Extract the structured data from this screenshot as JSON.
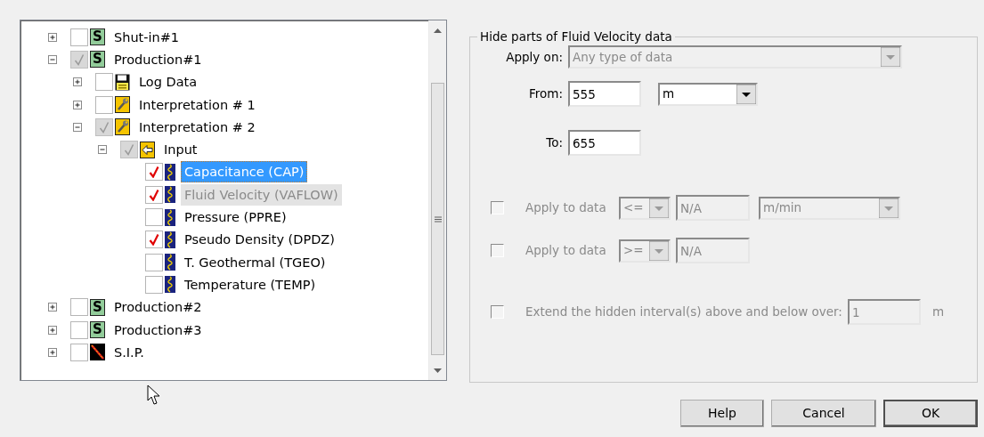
{
  "tree": [
    {
      "label": "Shut-in#1",
      "kind": "s",
      "icon_letter": "S",
      "checked": false,
      "selected": false,
      "dimmed": false,
      "expanded": false
    },
    {
      "label": "Production#1",
      "kind": "s",
      "icon_letter": "S",
      "checked": true,
      "greyed": true,
      "selected": false,
      "dimmed": false,
      "expanded": true,
      "children": [
        {
          "label": "Log Data",
          "kind": "disk",
          "checked": false,
          "selected": false,
          "dimmed": false,
          "expanded": false
        },
        {
          "label": "Interpretation # 1",
          "kind": "wrench",
          "checked": false,
          "selected": false,
          "dimmed": false,
          "expanded": false
        },
        {
          "label": "Interpretation # 2",
          "kind": "wrench",
          "checked": true,
          "greyed": true,
          "selected": false,
          "dimmed": false,
          "expanded": true,
          "children": [
            {
              "label": "Input",
              "kind": "input",
              "checked": true,
              "greyed": true,
              "selected": false,
              "dimmed": false,
              "expanded": true,
              "children": [
                {
                  "label": "Capacitance (CAP)",
                  "kind": "curve",
                  "checked": true,
                  "greyed": false,
                  "selected": true,
                  "dimmed": false
                },
                {
                  "label": "Fluid Velocity (VAFLOW)",
                  "kind": "curve",
                  "checked": true,
                  "greyed": false,
                  "selected": false,
                  "dimmed": true
                },
                {
                  "label": "Pressure (PPRE)",
                  "kind": "curve",
                  "checked": false,
                  "selected": false,
                  "dimmed": false
                },
                {
                  "label": "Pseudo Density (DPDZ)",
                  "kind": "curve",
                  "checked": true,
                  "greyed": false,
                  "selected": false,
                  "dimmed": false
                },
                {
                  "label": "T. Geothermal (TGEO)",
                  "kind": "curve",
                  "checked": false,
                  "selected": false,
                  "dimmed": false
                },
                {
                  "label": "Temperature (TEMP)",
                  "kind": "curve",
                  "checked": false,
                  "selected": false,
                  "dimmed": false
                }
              ]
            }
          ]
        }
      ]
    },
    {
      "label": "Production#2",
      "kind": "s",
      "icon_letter": "S",
      "checked": false,
      "selected": false,
      "dimmed": false,
      "expanded": false
    },
    {
      "label": "Production#3",
      "kind": "s",
      "icon_letter": "S",
      "checked": false,
      "selected": false,
      "dimmed": false,
      "expanded": false
    },
    {
      "label": "S.I.P.",
      "kind": "sip",
      "checked": false,
      "selected": false,
      "dimmed": false,
      "expanded": false
    }
  ],
  "group": {
    "title": "Hide parts of Fluid Velocity data",
    "apply_on": {
      "label": "Apply on:",
      "value": "Any type of data",
      "disabled": true
    },
    "from": {
      "label": "From:",
      "value": "555",
      "unit": "m"
    },
    "to": {
      "label": "To:",
      "value": "655"
    },
    "filters": [
      {
        "label": "Apply to data",
        "checked": false,
        "disabled": true,
        "operator": "<=",
        "value": "N/A",
        "unit": "m/min"
      },
      {
        "label": "Apply to data",
        "checked": false,
        "disabled": true,
        "operator": ">=",
        "value": "N/A"
      }
    ],
    "extend": {
      "label": "Extend the hidden interval(s) above and below over:",
      "checked": false,
      "disabled": true,
      "value": "1",
      "unit": "m"
    }
  },
  "buttons": [
    {
      "label": "Help",
      "default": false
    },
    {
      "label": "Cancel",
      "default": false
    },
    {
      "label": "OK",
      "default": true
    }
  ]
}
